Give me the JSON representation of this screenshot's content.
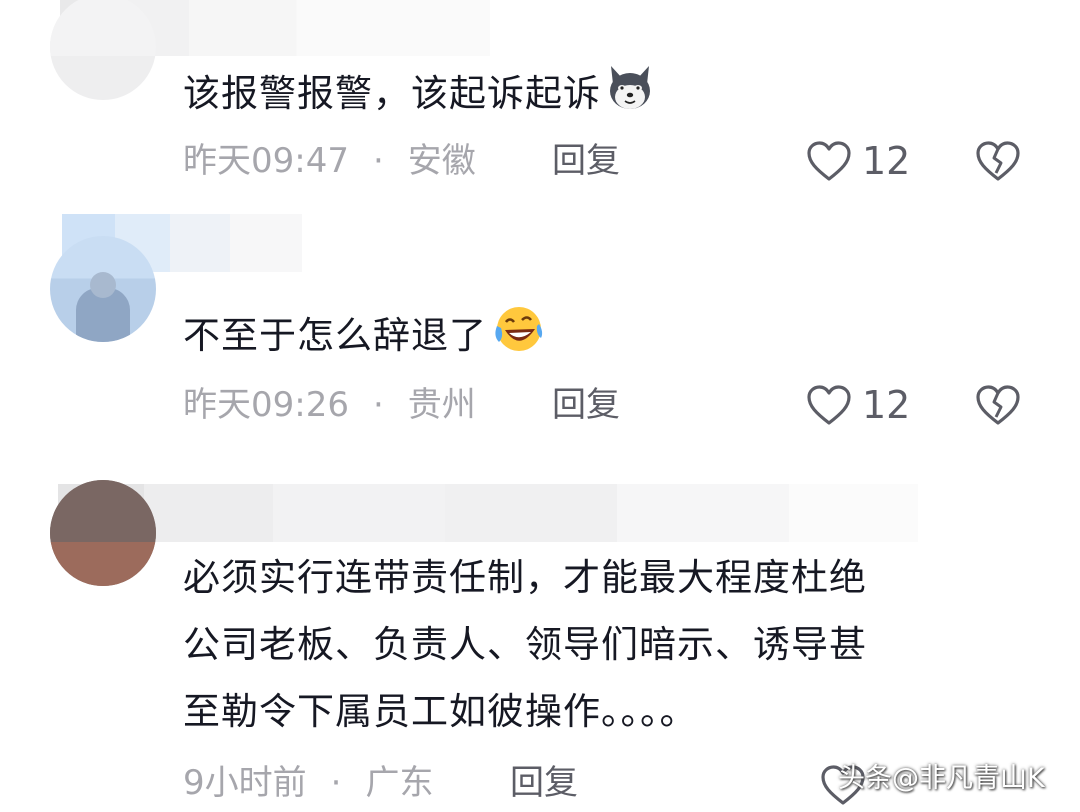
{
  "comments": [
    {
      "text": "该报警报警，该起诉起诉",
      "emoji": "husky-dog-emoji",
      "time": "昨天09:47",
      "separator": "·",
      "location": "安徽",
      "reply_label": "回复",
      "likes": "12"
    },
    {
      "text": "不至于怎么辞退了",
      "emoji": "laughing-crying-emoji",
      "time": "昨天09:26",
      "separator": "·",
      "location": "贵州",
      "reply_label": "回复",
      "likes": "12"
    },
    {
      "text_lines": [
        "必须实行连带责任制，才能最大程度杜绝",
        "公司老板、负责人、领导们暗示、诱导甚",
        "至勒令下属员工如彼操作。。。。"
      ],
      "time": "9小时前",
      "separator": "·",
      "location": "广东",
      "reply_label": "回复"
    }
  ],
  "icons": {
    "like": "heart-outline-icon",
    "dislike": "broken-heart-icon"
  },
  "watermark": "头条@非凡青山K",
  "colors": {
    "text_primary": "#161823",
    "text_meta": "#a6a6ac",
    "text_action": "#5c5d66",
    "background": "#ffffff"
  }
}
